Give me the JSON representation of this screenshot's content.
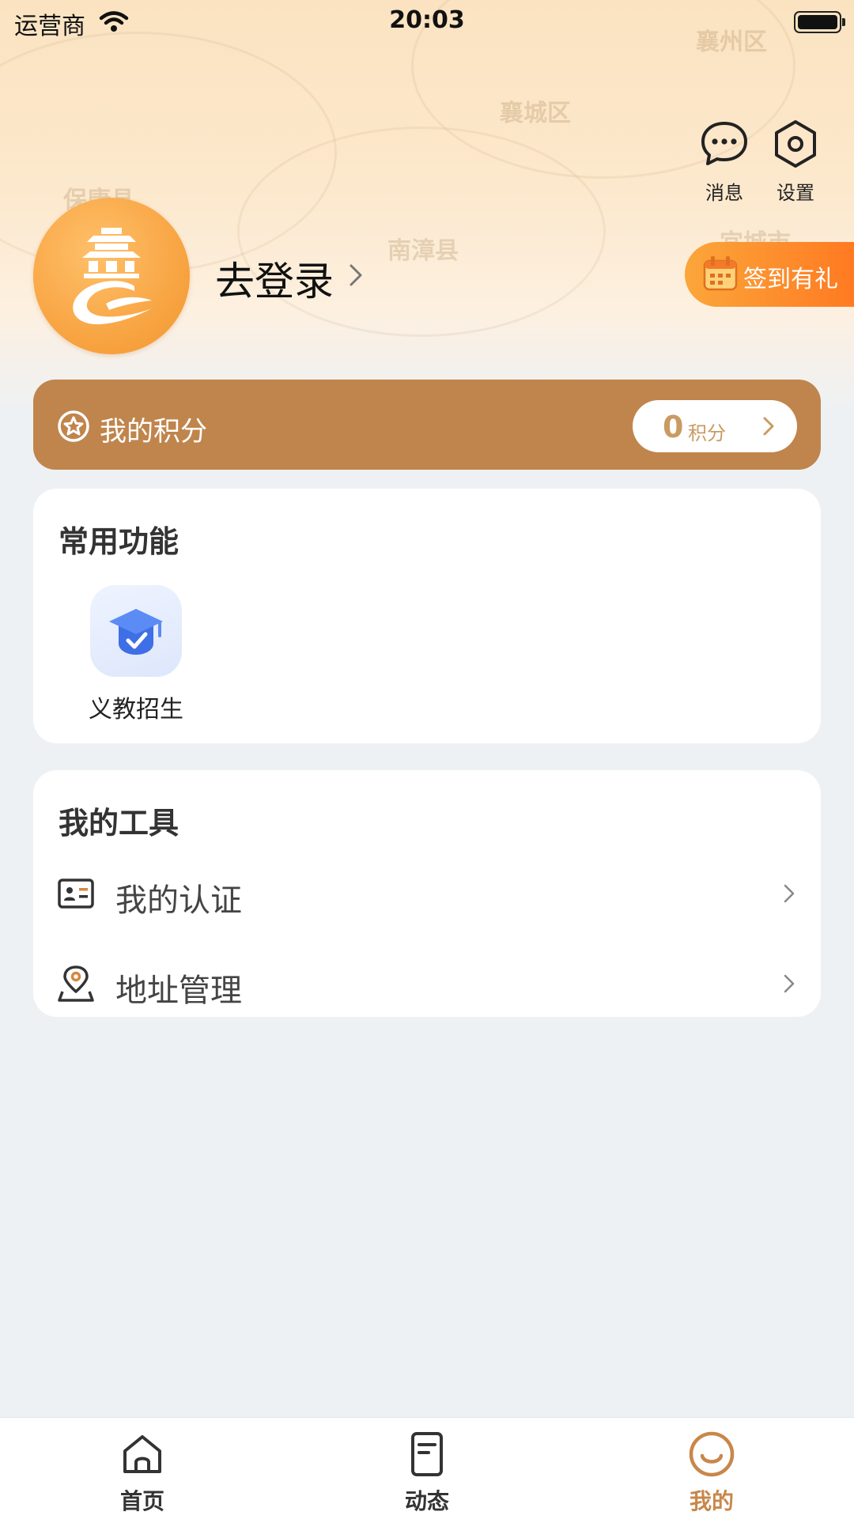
{
  "status_bar": {
    "carrier": "运营商",
    "time": "20:03"
  },
  "header_map_labels": [
    "襄州区",
    "襄城区",
    "保康县",
    "南漳县",
    "宜城市"
  ],
  "top_actions": {
    "messages": "消息",
    "settings": "设置"
  },
  "profile": {
    "login_label": "去登录"
  },
  "signin": {
    "label": "签到有礼"
  },
  "points": {
    "title": "我的积分",
    "value": "0",
    "unit": "积分"
  },
  "common_functions": {
    "title": "常用功能",
    "items": [
      {
        "label": "义教招生",
        "icon": "graduation-cap-icon"
      }
    ]
  },
  "tools": {
    "title": "我的工具",
    "items": [
      {
        "label": "我的认证",
        "icon": "id-card-icon"
      },
      {
        "label": "地址管理",
        "icon": "location-pin-icon"
      }
    ]
  },
  "bottom_nav": {
    "items": [
      {
        "label": "首页",
        "icon": "home-icon"
      },
      {
        "label": "动态",
        "icon": "document-icon"
      },
      {
        "label": "我的",
        "icon": "profile-icon"
      }
    ],
    "active_index": 2
  },
  "colors": {
    "accent": "#c8874a",
    "points_bar": "#c0854c",
    "signin_start": "#fba63a",
    "signin_end": "#ff7a22",
    "avatar": "#f7a13e",
    "func_icon_blue": "#4a7df0"
  }
}
